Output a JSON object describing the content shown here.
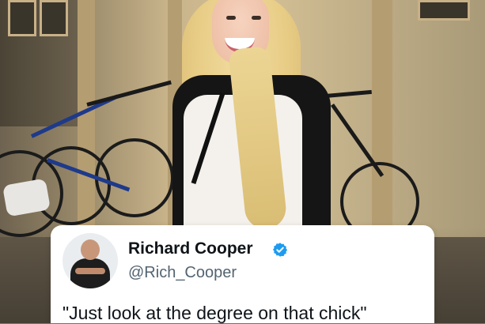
{
  "tweet": {
    "author_name": "Richard Cooper",
    "author_handle": "@Rich_Cooper",
    "verified": true,
    "text": "\"Just look at the degree on that chick\""
  },
  "colors": {
    "verified_badge": "#1d9bf0",
    "name_text": "#0f1419",
    "handle_text": "#536471",
    "card_background": "#ffffff"
  },
  "icons": {
    "verified": "verified-badge-icon"
  }
}
